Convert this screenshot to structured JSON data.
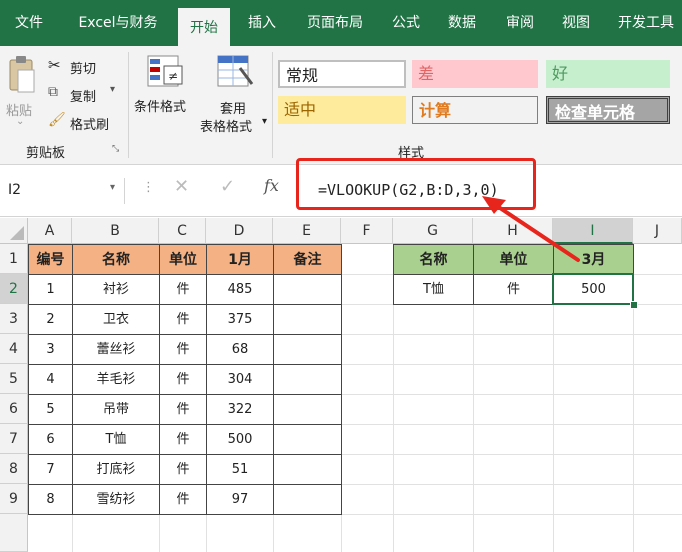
{
  "tabs": [
    "文件",
    "Excel与财务",
    "开始",
    "插入",
    "页面布局",
    "公式",
    "数据",
    "审阅",
    "视图",
    "开发工具"
  ],
  "clipboard": {
    "paste": "粘贴",
    "cut": "剪切",
    "copy": "复制",
    "format_painter": "格式刷",
    "group_label": "剪贴板"
  },
  "conditional_format": "条件格式",
  "table_format": {
    "line1": "套用",
    "line2": "表格格式"
  },
  "styles": {
    "group_label": "样式",
    "normal": "常规",
    "bad": "差",
    "good": "好",
    "neutral": "适中",
    "calculation": "计算",
    "check_cell": "检查单元格"
  },
  "formula_bar": {
    "name_box": "I2",
    "fx": "fx",
    "formula": "=VLOOKUP(G2,B:D,3,0)"
  },
  "columns": [
    "A",
    "B",
    "C",
    "D",
    "E",
    "F",
    "G",
    "H",
    "I",
    "J"
  ],
  "rows": [
    "1",
    "2",
    "3",
    "4",
    "5",
    "6",
    "7",
    "8",
    "9"
  ],
  "table1": {
    "headers": [
      "编号",
      "名称",
      "单位",
      "1月",
      "备注"
    ],
    "rows": [
      [
        "1",
        "衬衫",
        "件",
        "485",
        ""
      ],
      [
        "2",
        "卫衣",
        "件",
        "375",
        ""
      ],
      [
        "3",
        "蕾丝衫",
        "件",
        "68",
        ""
      ],
      [
        "4",
        "羊毛衫",
        "件",
        "304",
        ""
      ],
      [
        "5",
        "吊带",
        "件",
        "322",
        ""
      ],
      [
        "6",
        "T恤",
        "件",
        "500",
        ""
      ],
      [
        "7",
        "打底衫",
        "件",
        "51",
        ""
      ],
      [
        "8",
        "雪纺衫",
        "件",
        "97",
        ""
      ]
    ]
  },
  "table2": {
    "headers": [
      "名称",
      "单位",
      "3月"
    ],
    "row": [
      "T恤",
      "件",
      "500"
    ]
  },
  "colors": {
    "ribbon_green": "#217346",
    "header_orange": "#f4b183",
    "header_green": "#a9d08e",
    "highlight_red": "#e8251c"
  }
}
